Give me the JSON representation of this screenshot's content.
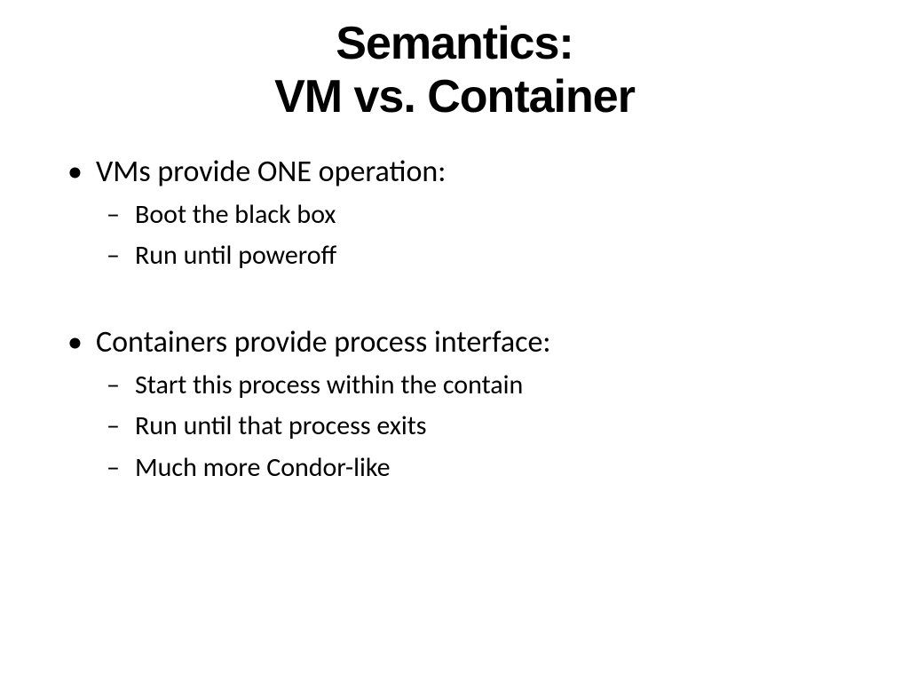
{
  "title": {
    "line1": "Semantics:",
    "line2": "VM vs. Container"
  },
  "bullets": [
    {
      "text": "VMs provide ONE operation:",
      "subs": [
        "Boot the black box",
        "Run until poweroff"
      ]
    },
    {
      "text": "Containers provide process interface:",
      "subs": [
        "Start this process within the contain",
        "Run until that process exits",
        "Much more Condor-like"
      ]
    }
  ]
}
